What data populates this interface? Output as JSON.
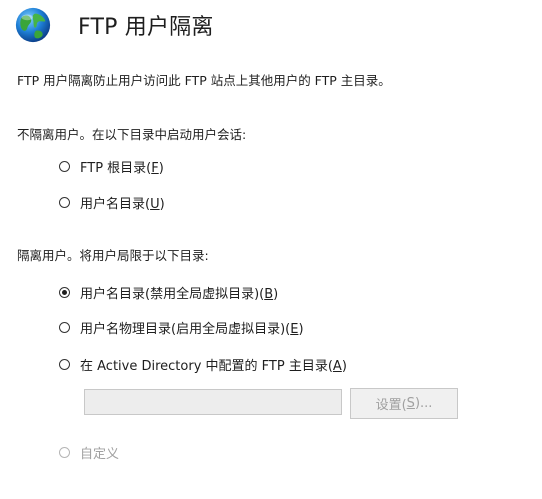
{
  "header": {
    "title": "FTP 用户隔离",
    "icon": "globe-icon"
  },
  "description": "FTP 用户隔离防止用户访问此 FTP 站点上其他用户的 FTP 主目录。",
  "no_isolation": {
    "label": "不隔离用户。在以下目录中启动用户会话:",
    "options": [
      {
        "text": "FTP 根目录(",
        "key": "F",
        "suffix": ")",
        "selected": false
      },
      {
        "text": "用户名目录(",
        "key": "U",
        "suffix": ")",
        "selected": false
      }
    ]
  },
  "isolation": {
    "label": "隔离用户。将用户局限于以下目录:",
    "options": [
      {
        "text": "用户名目录(禁用全局虚拟目录)(",
        "key": "B",
        "suffix": ")",
        "selected": true
      },
      {
        "text": "用户名物理目录(启用全局虚拟目录)(",
        "key": "E",
        "suffix": ")",
        "selected": false
      },
      {
        "text": "在 Active Directory 中配置的 FTP 主目录(",
        "key": "A",
        "suffix": ")",
        "selected": false
      }
    ]
  },
  "ad_path": {
    "value": "",
    "settings_text": "设置(",
    "settings_key": "S",
    "settings_suffix": ")..."
  },
  "custom": {
    "label": "自定义",
    "enabled": false
  }
}
